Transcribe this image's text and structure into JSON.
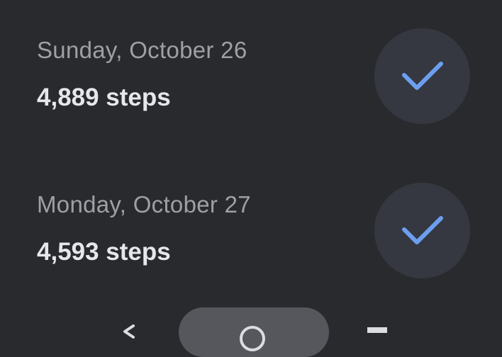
{
  "days": [
    {
      "date": "Sunday, October 26",
      "steps": "4,889 steps",
      "status_icon": "checkmark-icon"
    },
    {
      "date": "Monday, October 27",
      "steps": "4,593 steps",
      "status_icon": "checkmark-icon"
    }
  ],
  "colors": {
    "background": "#292a2e",
    "check_circle": "#353840",
    "check_mark": "#6d9ff0",
    "date_text": "#9ea0a5",
    "steps_text": "#e6e7ea"
  },
  "nav": {
    "back_icon": "back-icon",
    "home_icon": "home-icon",
    "recents_icon": "recents-icon"
  }
}
